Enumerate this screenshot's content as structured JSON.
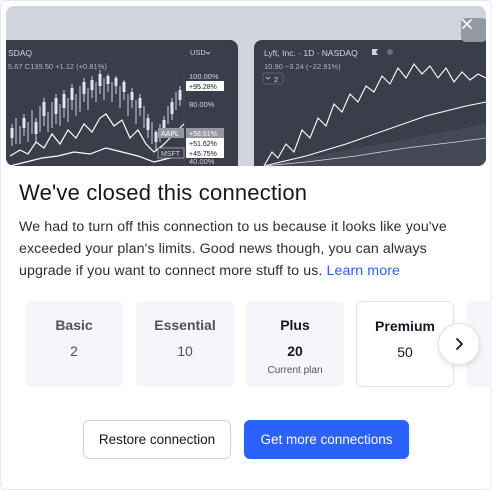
{
  "hero": {
    "left_chart": {
      "symbol": "SDAQ",
      "ohlc": "5.67 C139.50 +1.12 (+0.81%)",
      "currency": "USD",
      "axis_labels": [
        "100.00%",
        "80.00%",
        "40.00%"
      ],
      "badges": [
        "+95.28%",
        "AAPL",
        "+58.61%",
        "+51.62%",
        "MSFT",
        "+45.75%"
      ]
    },
    "right_chart": {
      "title": "Lyft, Inc. · 1D · NASDAQ",
      "price_line": "10.90 −3.24 (−22.91%)",
      "indicator_count": "2"
    },
    "close_icon": "close-icon"
  },
  "dialog": {
    "title": "We've closed this connection",
    "body": "We had to turn off this connection to us because it looks like you've exceeded your plan's limits. Good news though, you can always upgrade if you want to connect more stuff to us.",
    "learn_more": "Learn more"
  },
  "plans": [
    {
      "name": "Basic",
      "value": "2"
    },
    {
      "name": "Essential",
      "value": "10"
    },
    {
      "name": "Plus",
      "value": "20",
      "note": "Current plan"
    },
    {
      "name": "Premium",
      "value": "50"
    }
  ],
  "next_icon": "chevron-right-icon",
  "buttons": {
    "restore": "Restore connection",
    "get_more": "Get more connections"
  },
  "colors": {
    "accent": "#2962ff",
    "hero_bg": "#d1d4dc",
    "chart_panel": "#3a3e4a"
  }
}
